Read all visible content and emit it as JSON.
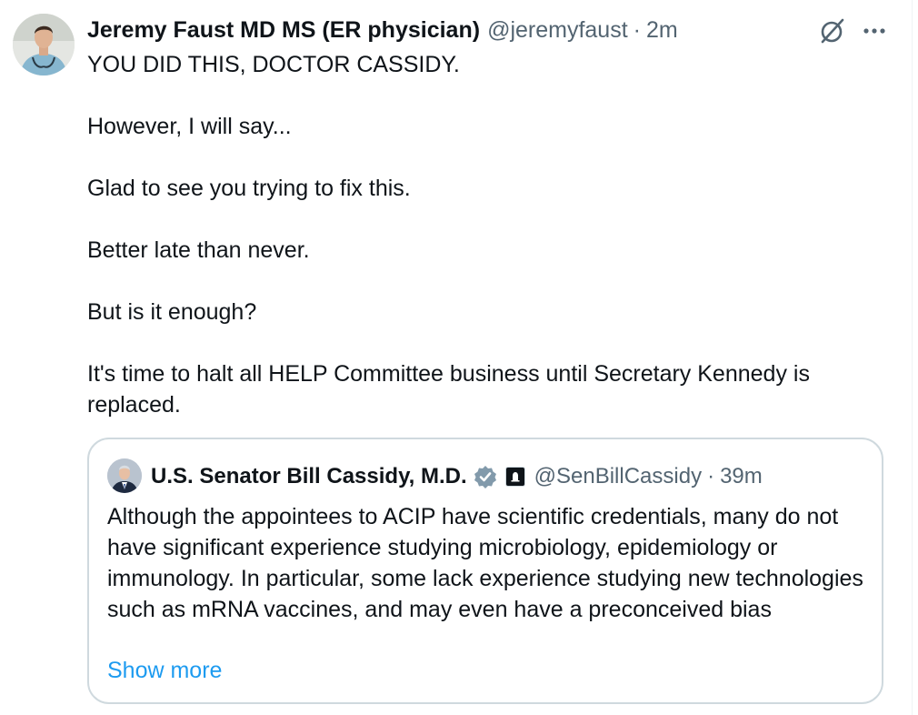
{
  "tweet": {
    "author": {
      "display_name": "Jeremy Faust MD MS (ER physician)",
      "handle": "@jeremyfaust",
      "time": "2m"
    },
    "separator": "·",
    "icons": {
      "avatar": "avatar-photo",
      "grok": "grok-icon",
      "more": "more-icon"
    },
    "paragraphs": [
      "YOU DID THIS, DOCTOR CASSIDY.",
      "However, I will say...",
      "Glad to see you trying to fix this.",
      "Better late than never.",
      "But is it enough?",
      "It's time to halt all HELP Committee business until Secretary Kennedy is replaced."
    ]
  },
  "quoted_tweet": {
    "author": {
      "display_name": "U.S. Senator Bill Cassidy, M.D.",
      "handle": "@SenBillCassidy",
      "time": "39m"
    },
    "separator": "·",
    "icons": {
      "verified": "verified-badge-icon",
      "affiliation": "government-building-icon"
    },
    "text": "Although the appointees to ACIP have scientific credentials, many do not have significant experience studying microbiology, epidemiology or immunology. In particular, some lack experience studying new technologies such as mRNA vaccines, and may even have a preconceived bias",
    "show_more_label": "Show more"
  },
  "colors": {
    "text_primary": "#0f1419",
    "text_secondary": "#536471",
    "link": "#1d9bf0",
    "border": "#cfd9de",
    "verified_badge": "#829aab"
  }
}
